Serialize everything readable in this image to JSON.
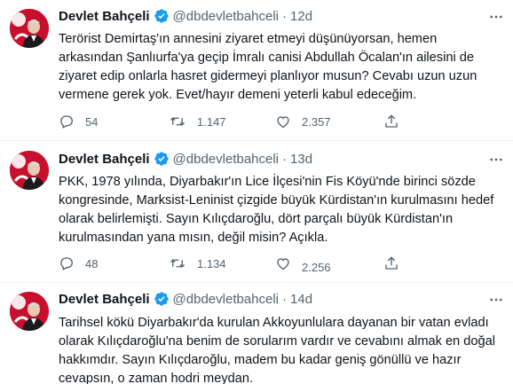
{
  "tweets": [
    {
      "name": "Devlet Bahçeli",
      "handle": "@dbdevletbahceli",
      "separator": "·",
      "time": "12d",
      "lines": [
        "Terörist Demirtaş'ın annesini ziyaret etmeyi düşünüyorsan, hemen",
        "arkasından Şanlıurfa'ya geçip İmralı canisi Abdullah Öcalan'ın ailesini de",
        "ziyaret edip onlarla hasret gidermeyi planlıyor musun? Cevabı uzun uzun",
        "vermene gerek yok. Evet/hayır demeni yeterli kabul edeceğim."
      ],
      "replies": "54",
      "retweets": "1.147",
      "likes": "2.357"
    },
    {
      "name": "Devlet Bahçeli",
      "handle": "@dbdevletbahceli",
      "separator": "·",
      "time": "13d",
      "lines": [
        "PKK, 1978 yılında, Diyarbakır'ın Lice İlçesi'nin Fis Köyü'nde birinci sözde",
        "kongresinde, Marksist-Leninist çizgide büyük Kürdistan'ın kurulmasını hedef",
        "olarak belirlemişti. Sayın Kılıçdaroğlu, dört parçalı büyük Kürdistan'ın",
        "kurulmasından yana mısın, değil misin? Açıkla."
      ],
      "replies": "48",
      "retweets": "1.134",
      "likes": "2.256"
    },
    {
      "name": "Devlet Bahçeli",
      "handle": "@dbdevletbahceli",
      "separator": "·",
      "time": "14d",
      "lines": [
        "Tarihsel kökü Diyarbakır'da kurulan Akkoyunlulara dayanan bir vatan evladı",
        "olarak Kılıçdaroğlu'na benim de sorularım vardır ve cevabını almak en doğal",
        "hakkımdır. Sayın Kılıçdaroğlu, madem bu kadar geniş gönüllü ve hazır",
        "cevapsın, o zaman hodri meydan."
      ]
    }
  ],
  "colors": {
    "text": "#0f1419",
    "secondary": "#536471",
    "verified": "#1d9bf0",
    "divider": "#eff3f4",
    "avatar_bg": "#c8102e"
  },
  "icons": [
    "verified-badge-icon",
    "more-icon",
    "reply-icon",
    "retweet-icon",
    "like-icon",
    "share-icon"
  ]
}
